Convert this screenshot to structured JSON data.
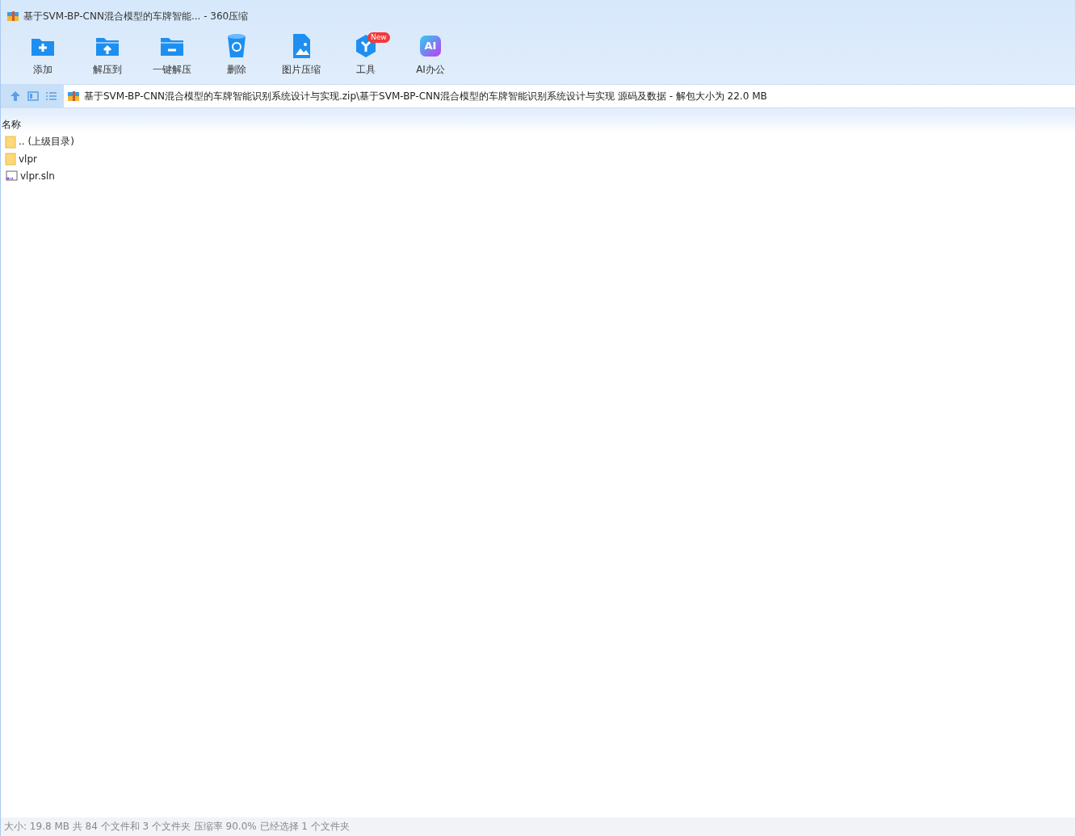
{
  "window": {
    "title": "基于SVM-BP-CNN混合模型的车牌智能... - 360压缩"
  },
  "toolbar": [
    {
      "kind": "add",
      "label": "添加"
    },
    {
      "kind": "extract",
      "label": "解压到"
    },
    {
      "kind": "oneclick",
      "label": "一键解压"
    },
    {
      "kind": "delete",
      "label": "删除"
    },
    {
      "kind": "image",
      "label": "图片压缩"
    },
    {
      "kind": "tools",
      "label": "工具",
      "badge": "New"
    },
    {
      "kind": "ai",
      "label": "AI办公",
      "icon_text": "AI"
    }
  ],
  "address": {
    "path": "基于SVM-BP-CNN混合模型的车牌智能识别系统设计与实现.zip\\基于SVM-BP-CNN混合模型的车牌智能识别系统设计与实现 源码及数据 - 解包大小为 22.0 MB"
  },
  "table": {
    "columns": [
      "名称"
    ],
    "rows": [
      {
        "kind": "folder",
        "name": ".. (上级目录)"
      },
      {
        "kind": "folder",
        "name": "vlpr"
      },
      {
        "kind": "sln",
        "name": "vlpr.sln"
      }
    ]
  },
  "status_bar": "大小: 19.8 MB 共 84 个文件和 3 个文件夹 压缩率 90.0% 已经选择 1 个文件夹"
}
